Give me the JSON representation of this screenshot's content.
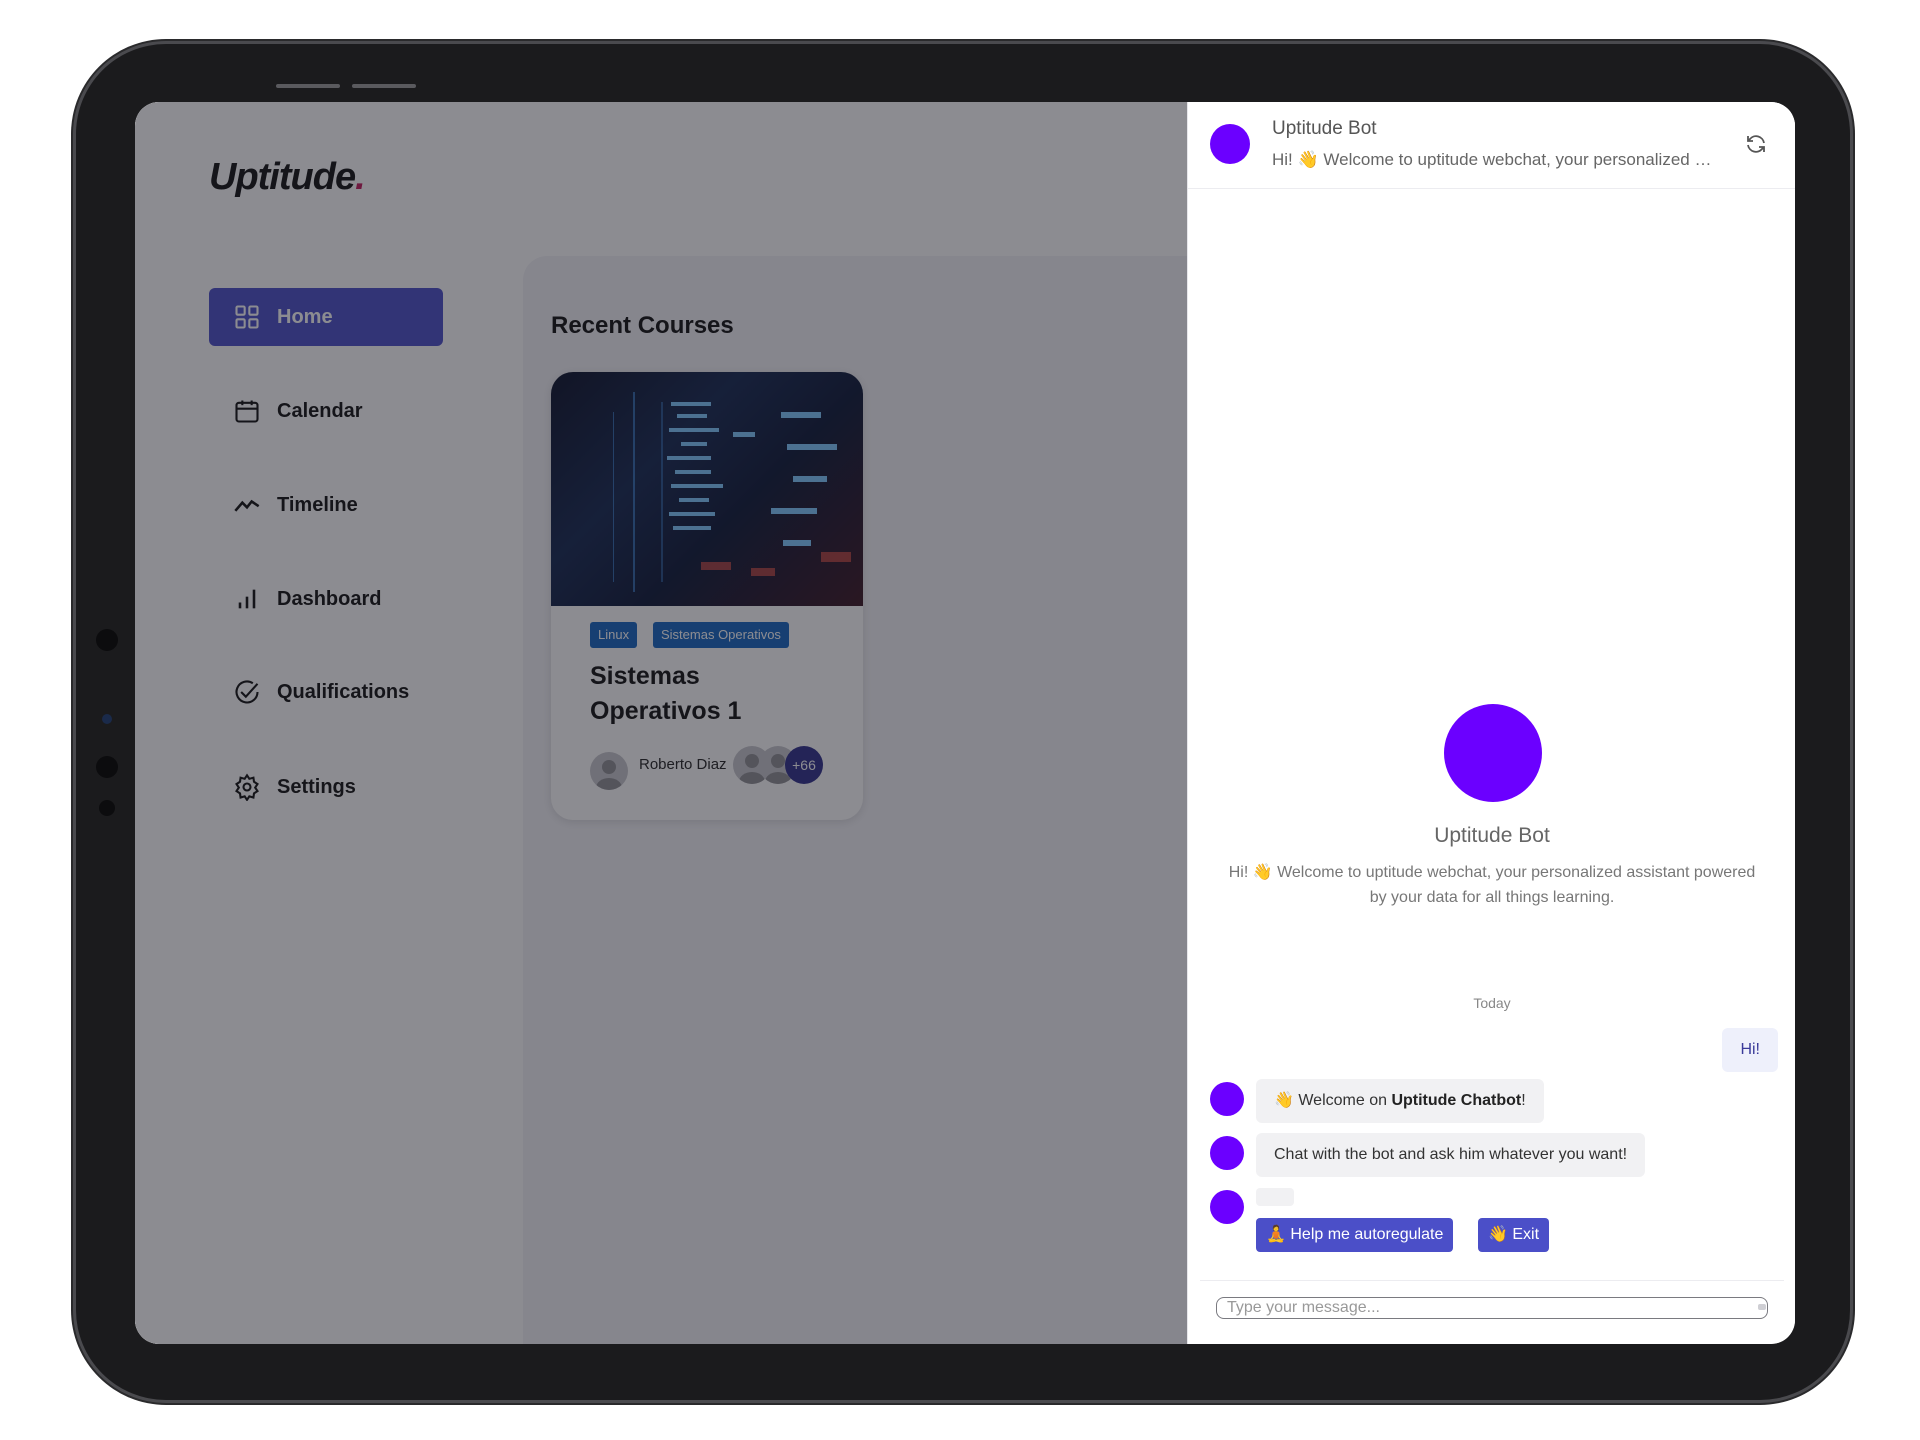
{
  "app": {
    "logo_text": "Uptitude",
    "logo_dot": ".",
    "nav": [
      {
        "label": "Home",
        "icon": "grid-icon",
        "active": true
      },
      {
        "label": "Calendar",
        "icon": "calendar-icon",
        "active": false
      },
      {
        "label": "Timeline",
        "icon": "trend-line-icon",
        "active": false
      },
      {
        "label": "Dashboard",
        "icon": "bar-chart-icon",
        "active": false
      },
      {
        "label": "Qualifications",
        "icon": "check-circle-icon",
        "active": false
      },
      {
        "label": "Settings",
        "icon": "gear-icon",
        "active": false
      }
    ],
    "section_title": "Recent Courses",
    "course": {
      "tags": [
        "Linux",
        "Sistemas Operativos"
      ],
      "title": "Sistemas Operativos 1",
      "author": "Roberto Diaz",
      "participants_extra": "+66"
    }
  },
  "chat": {
    "bot_name": "Uptitude Bot",
    "header_subtitle": "Hi! 👋 Welcome to uptitude webchat, your personalized assistant powered by your data for all things learning.",
    "intro_name": "Uptitude Bot",
    "intro_text": "Hi! 👋 Welcome to uptitude webchat, your personalized assistant powered by your data for all things learning.",
    "day_label": "Today",
    "user_message": "Hi!",
    "bot_messages": {
      "welcome_prefix": "👋 Welcome on ",
      "welcome_bold": "Uptitude Chatbot",
      "welcome_suffix": "!",
      "second": "Chat with the bot and ask him whatever you want!"
    },
    "quick_replies": [
      "🧘 Help me autoregulate",
      "👋 Exit"
    ],
    "input_placeholder": "Type your message...",
    "colors": {
      "bot_avatar": "#6b00ff",
      "accent": "#4b4fc8",
      "tag": "#1565c0"
    }
  }
}
